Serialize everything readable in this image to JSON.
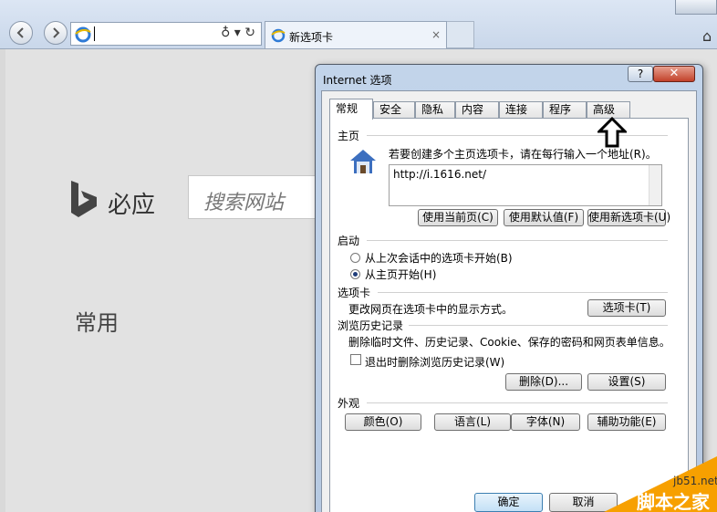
{
  "browser": {
    "address_value": "",
    "tab_label": "新选项卡",
    "tab_close": "×",
    "address_tools": "♁ ▾ ↻",
    "home_glyph": "⌂"
  },
  "page": {
    "brand": "必应",
    "search_placeholder": "搜索网站",
    "section": "常用"
  },
  "dialog": {
    "title": "Internet 选项",
    "help_label": "?",
    "close_label": "✕",
    "tabs": [
      "常规",
      "安全",
      "隐私",
      "内容",
      "连接",
      "程序",
      "高级"
    ],
    "homepage": {
      "heading": "主页",
      "instruction": "若要创建多个主页选项卡，请在每行输入一个地址(R)。",
      "url": "http://i.1616.net/",
      "use_current": "使用当前页(C)",
      "use_default": "使用默认值(F)",
      "use_new_tab": "使用新选项卡(U)"
    },
    "startup": {
      "heading": "启动",
      "option1": "从上次会话中的选项卡开始(B)",
      "option2": "从主页开始(H)",
      "selected": 2
    },
    "tabs_section": {
      "heading": "选项卡",
      "description": "更改网页在选项卡中的显示方式。",
      "button": "选项卡(T)"
    },
    "history": {
      "heading": "浏览历史记录",
      "description": "删除临时文件、历史记录、Cookie、保存的密码和网页表单信息。",
      "checkbox_label": "退出时删除浏览历史记录(W)",
      "checked": false,
      "delete_button": "删除(D)...",
      "settings_button": "设置(S)"
    },
    "appearance": {
      "heading": "外观",
      "colors": "颜色(O)",
      "languages": "语言(L)",
      "fonts": "字体(N)",
      "accessibility": "辅助功能(E)"
    },
    "ok_button": "确定",
    "cancel_button": "取消"
  },
  "watermark": {
    "site": "jb51.net",
    "name": "脚本之家"
  },
  "colors": {
    "accent": "#f7a000",
    "close_red": "#c2412a",
    "dialog_frame": "#b6c9e2"
  }
}
